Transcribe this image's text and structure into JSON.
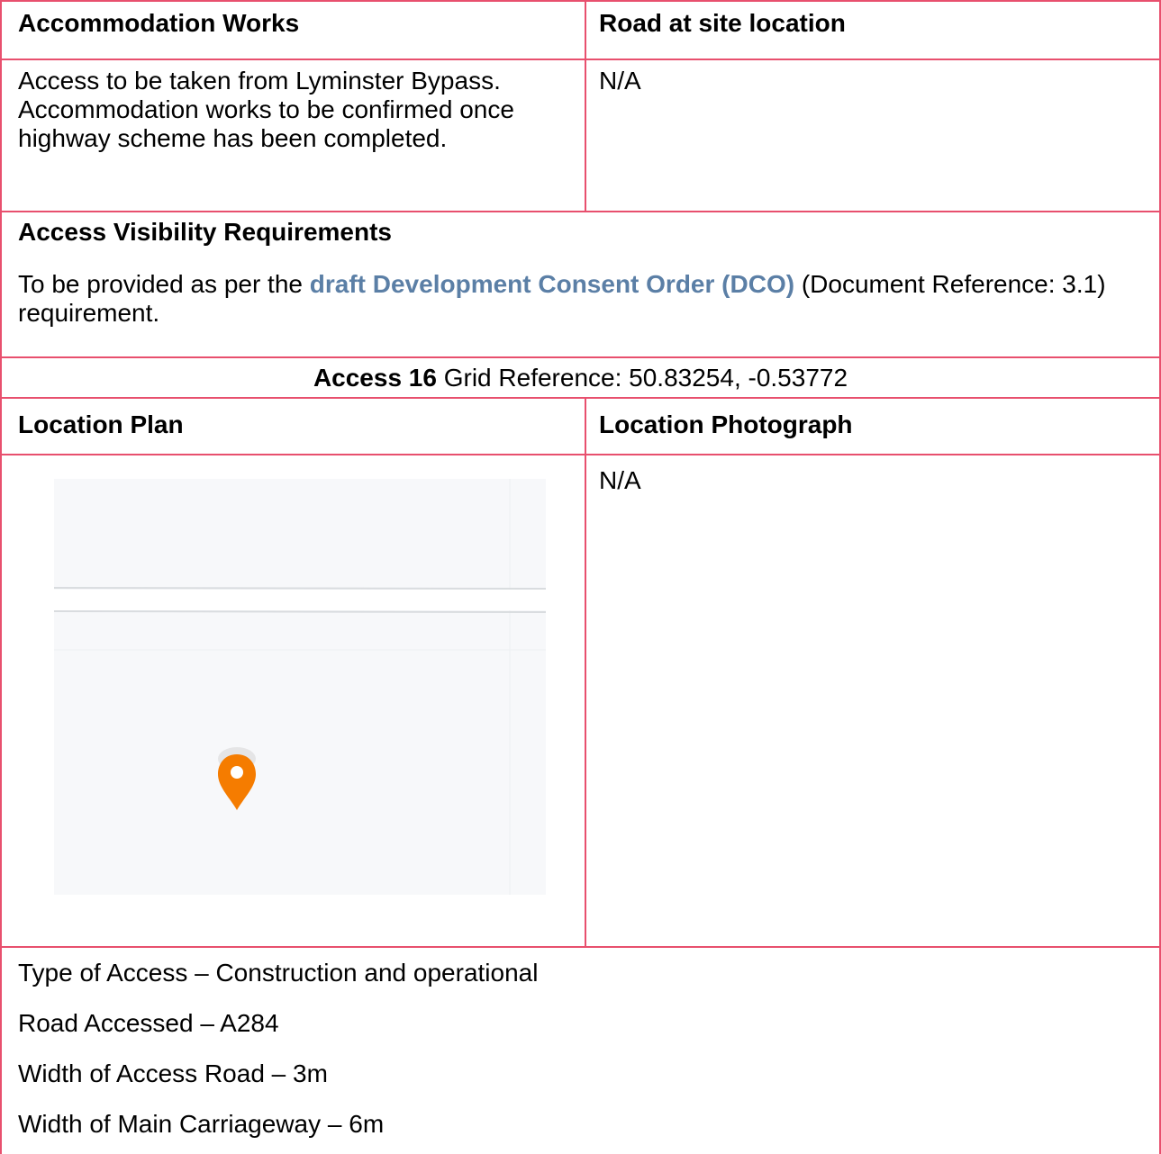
{
  "accommodation": {
    "header_left": "Accommodation Works",
    "header_right": "Road at site location",
    "body_left": "Access to be taken from Lyminster Bypass. Accommodation works to be confirmed once highway scheme has been completed.",
    "body_right": "N/A"
  },
  "visibility": {
    "heading": "Access Visibility Requirements",
    "text_before": "To be provided as per the ",
    "link_text": "draft Development Consent Order (DCO)",
    "text_after": " (Document Reference: 3.1) requirement."
  },
  "access": {
    "label": "Access 16",
    "grid_reference": " Grid Reference: 50.83254, -0.53772"
  },
  "location": {
    "plan_heading": "Location Plan",
    "photo_heading": "Location Photograph",
    "photo_value": "N/A",
    "map_marker_icon": "map-pin-icon",
    "marker_color": "#f57c00"
  },
  "details": [
    "Type of Access – Construction and operational",
    "Road Accessed – A284",
    "Width of Access Road – 3m",
    "Width of Main Carriageway – 6m"
  ]
}
